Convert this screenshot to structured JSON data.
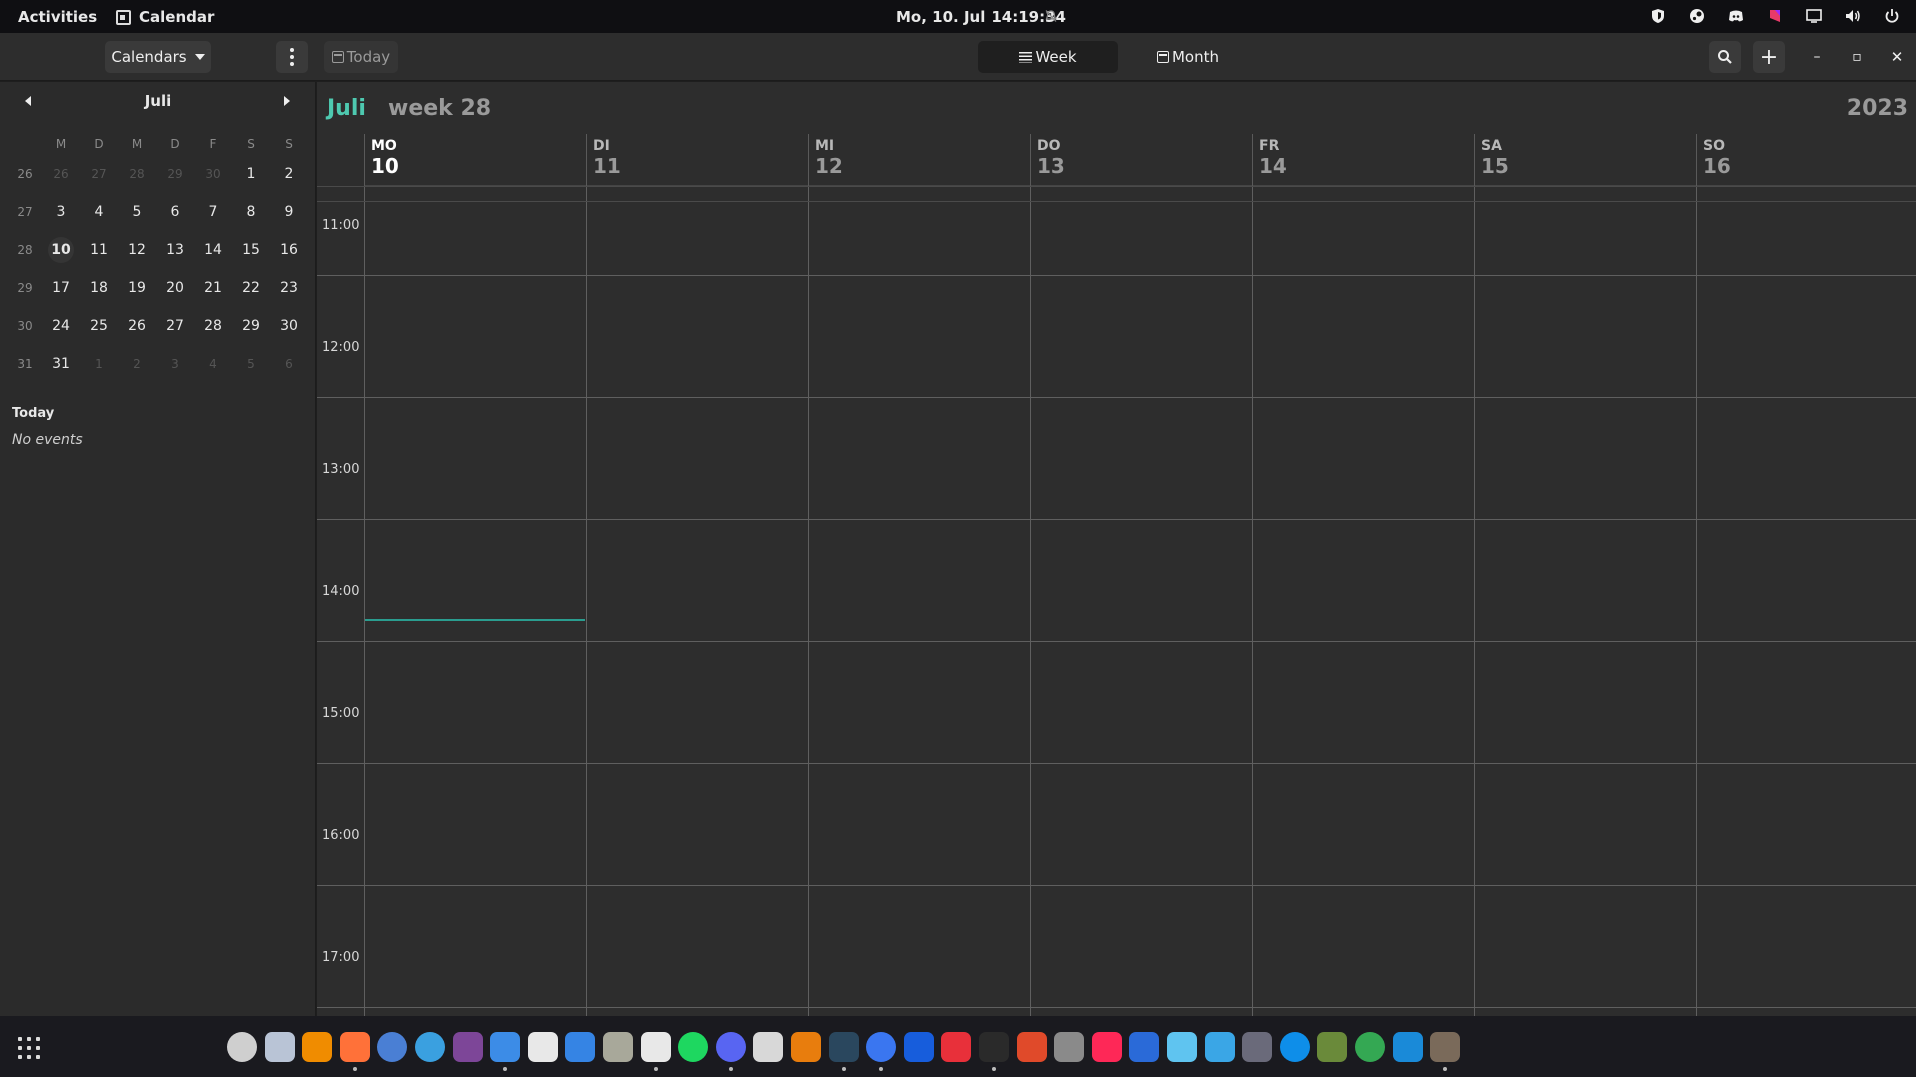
{
  "topbar": {
    "activities": "Activities",
    "app_name": "Calendar",
    "date": "Mo, 10. Jul",
    "time": "14:19:34"
  },
  "headerbar": {
    "calendars_label": "Calendars",
    "today_label": "Today",
    "view_week_label": "Week",
    "view_month_label": "Month",
    "add_label": "+",
    "minimize_label": "–",
    "maximize_label": "▫",
    "close_label": "✕"
  },
  "sidebar": {
    "month_name": "Juli",
    "weekday_headers": [
      "M",
      "D",
      "M",
      "D",
      "F",
      "S",
      "S"
    ],
    "weeks": [
      {
        "num": "26",
        "days": [
          "26",
          "27",
          "28",
          "29",
          "30",
          "1",
          "2"
        ]
      },
      {
        "num": "27",
        "days": [
          "3",
          "4",
          "5",
          "6",
          "7",
          "8",
          "9"
        ]
      },
      {
        "num": "28",
        "days": [
          "10",
          "11",
          "12",
          "13",
          "14",
          "15",
          "16"
        ]
      },
      {
        "num": "29",
        "days": [
          "17",
          "18",
          "19",
          "20",
          "21",
          "22",
          "23"
        ]
      },
      {
        "num": "30",
        "days": [
          "24",
          "25",
          "26",
          "27",
          "28",
          "29",
          "30"
        ]
      },
      {
        "num": "31",
        "days": [
          "31",
          "1",
          "2",
          "3",
          "4",
          "5",
          "6"
        ]
      }
    ],
    "agenda_title": "Today",
    "agenda_empty": "No events"
  },
  "week_view": {
    "month": "Juli",
    "week_label": "week 28",
    "year": "2023",
    "days": [
      {
        "abbr": "MO",
        "num": "10"
      },
      {
        "abbr": "DI",
        "num": "11"
      },
      {
        "abbr": "MI",
        "num": "12"
      },
      {
        "abbr": "DO",
        "num": "13"
      },
      {
        "abbr": "FR",
        "num": "14"
      },
      {
        "abbr": "SA",
        "num": "15"
      },
      {
        "abbr": "SO",
        "num": "16"
      }
    ],
    "times": [
      "11:00",
      "12:00",
      "13:00",
      "14:00",
      "15:00",
      "16:00",
      "17:00"
    ]
  },
  "colors": {
    "accent": "#4ec9b0",
    "now_line": "#2a9d8f"
  },
  "dock": {
    "apps": [
      {
        "name": "settings-icon",
        "color": "#cfcfcf"
      },
      {
        "name": "software-icon",
        "color": "#b9c4d6"
      },
      {
        "name": "vlc-icon",
        "color": "#f08c00"
      },
      {
        "name": "firefox-icon",
        "color": "#ff7139"
      },
      {
        "name": "chromium-icon",
        "color": "#4a7fd4"
      },
      {
        "name": "safari-like-icon",
        "color": "#3aa0e0"
      },
      {
        "name": "tor-icon",
        "color": "#7d4698"
      },
      {
        "name": "thunderbird-icon",
        "color": "#3c8ce7"
      },
      {
        "name": "text-editor-icon",
        "color": "#e8e8e8"
      },
      {
        "name": "notes-icon",
        "color": "#3584e4"
      },
      {
        "name": "files-icon",
        "color": "#a8a89a"
      },
      {
        "name": "calendar-icon",
        "color": "#e8e8e8"
      },
      {
        "name": "spotify-icon",
        "color": "#1ed760"
      },
      {
        "name": "discord-icon",
        "color": "#5865f2"
      },
      {
        "name": "remmina-icon",
        "color": "#d8d8d8"
      },
      {
        "name": "blender-icon",
        "color": "#e87d0d"
      },
      {
        "name": "steam-icon",
        "color": "#2a475e"
      },
      {
        "name": "signal-icon",
        "color": "#3a76f0"
      },
      {
        "name": "bitwarden-icon",
        "color": "#175ddc"
      },
      {
        "name": "downloader-icon",
        "color": "#e8303a"
      },
      {
        "name": "terminal-icon",
        "color": "#2a2a2a"
      },
      {
        "name": "office-icon",
        "color": "#e04a2a"
      },
      {
        "name": "aperture-icon",
        "color": "#8a8a8a"
      },
      {
        "name": "intellij-icon",
        "color": "#fe2857"
      },
      {
        "name": "docs-icon",
        "color": "#2a6ad8"
      },
      {
        "name": "proton-vpn-icon",
        "color": "#5fc4f0"
      },
      {
        "name": "edge-preview-icon",
        "color": "#3aa6e6"
      },
      {
        "name": "davinci-icon",
        "color": "#6a6a7a"
      },
      {
        "name": "teamviewer-icon",
        "color": "#0e8ee9"
      },
      {
        "name": "minecraft-icon",
        "color": "#6a8a3a"
      },
      {
        "name": "chrome-icon",
        "color": "#34a853"
      },
      {
        "name": "audio-meter-icon",
        "color": "#1a8ad8"
      },
      {
        "name": "gimp-icon",
        "color": "#7a6a5a"
      }
    ]
  }
}
